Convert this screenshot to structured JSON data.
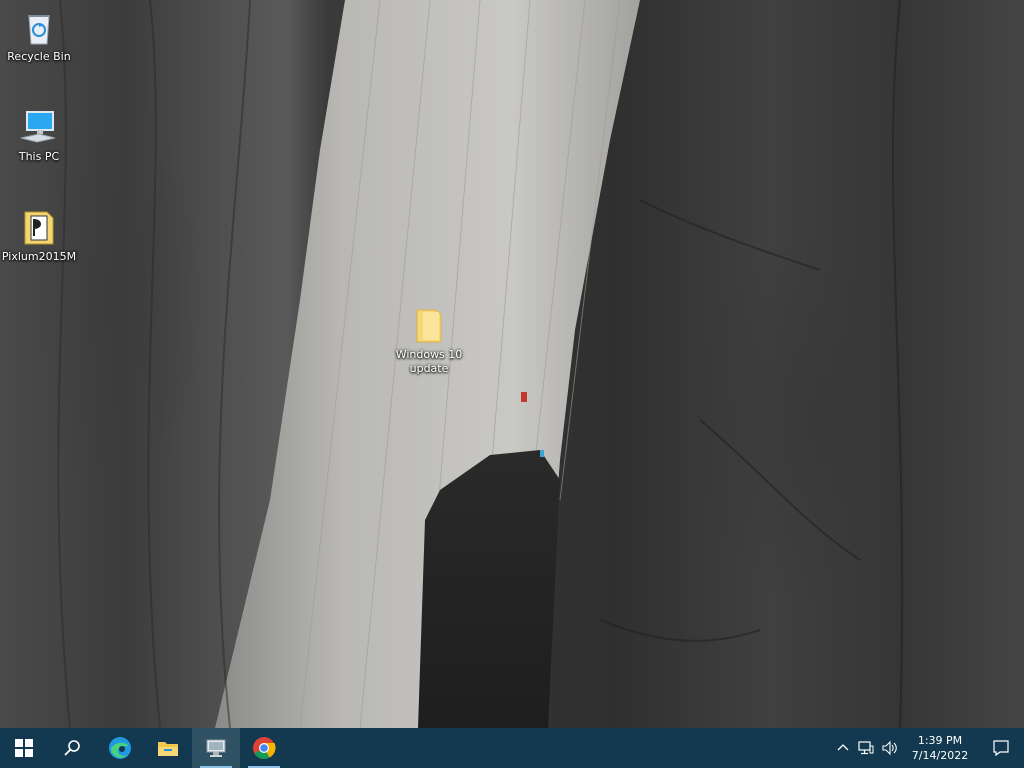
{
  "desktop": {
    "icons": [
      {
        "label": "Recycle Bin",
        "icon": "recycle-bin-icon"
      },
      {
        "label": "This PC",
        "icon": "computer-icon"
      },
      {
        "label": "Pixlum2015M",
        "icon": "document-icon"
      },
      {
        "label": "Windows 10 update",
        "icon": "folder-icon"
      }
    ]
  },
  "taskbar": {
    "buttons": [
      {
        "name": "Start",
        "icon": "windows-logo-icon"
      },
      {
        "name": "Search",
        "icon": "search-icon"
      },
      {
        "name": "Microsoft Edge",
        "icon": "edge-icon"
      },
      {
        "name": "File Explorer",
        "icon": "file-explorer-icon"
      },
      {
        "name": "Remote Desktop",
        "icon": "remote-desktop-icon"
      },
      {
        "name": "Google Chrome",
        "icon": "chrome-icon"
      }
    ],
    "tray": {
      "icons": [
        "chevron-up-icon",
        "network-icon",
        "volume-icon",
        "notification-icon"
      ],
      "time": "1:39 PM",
      "date": "7/14/2022"
    },
    "colors": {
      "background": "#12394f"
    }
  }
}
